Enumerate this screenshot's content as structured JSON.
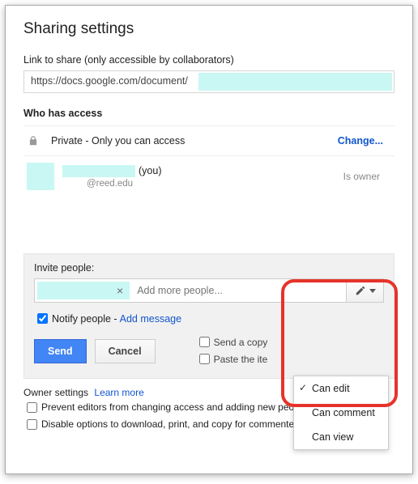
{
  "title": "Sharing settings",
  "link": {
    "label": "Link to share (only accessible by collaborators)",
    "value": "https://docs.google.com/document/d/"
  },
  "who": {
    "label": "Who has access",
    "private_text": "Private - Only you can access",
    "change": "Change..."
  },
  "user": {
    "you_suffix": "(you)",
    "email": "@reed.edu",
    "role": "Is owner"
  },
  "invite": {
    "label": "Invite people:",
    "placeholder": "Add more people...",
    "notify_label": "Notify people -",
    "add_message": "Add message",
    "send": "Send",
    "cancel": "Cancel",
    "send_copy": "Send a copy",
    "paste_item": "Paste the ite"
  },
  "dropdown": {
    "can_edit": "Can edit",
    "can_comment": "Can comment",
    "can_view": "Can view"
  },
  "owner": {
    "label": "Owner settings",
    "learn": "Learn more",
    "prevent": "Prevent editors from changing access and adding new people",
    "disable": "Disable options to download, print, and copy for commenters and viewers"
  }
}
